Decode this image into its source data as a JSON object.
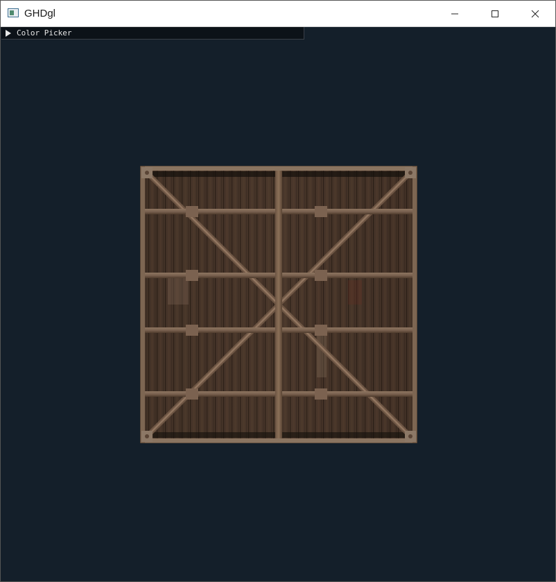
{
  "window": {
    "title": "GHDgl",
    "controls": {
      "minimize": "minimize-icon",
      "maximize": "maximize-icon",
      "close": "close-icon"
    }
  },
  "imgui": {
    "color_picker_label": "Color Picker",
    "collapsed": true,
    "arrow_icon": "triangle-right-icon"
  },
  "scene": {
    "background_color": "#141f2a",
    "object": "wooden-crate-texture"
  }
}
